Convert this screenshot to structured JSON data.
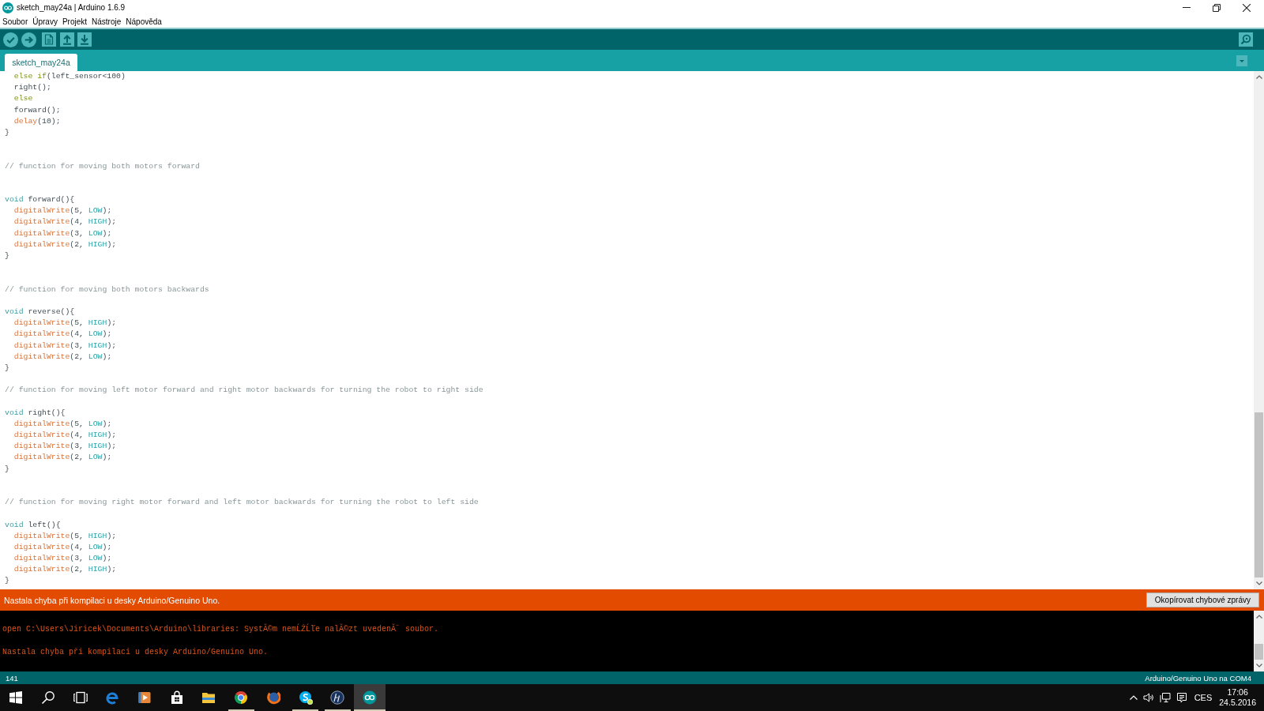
{
  "window": {
    "title": "sketch_may24a | Arduino 1.6.9"
  },
  "menu": [
    "Soubor",
    "Úpravy",
    "Projekt",
    "Nástroje",
    "Nápověda"
  ],
  "tabs": [
    {
      "label": "sketch_may24a",
      "selected": true
    }
  ],
  "editor": {
    "lines": [
      {
        "kind": "code",
        "tokens": [
          {
            "kind": "keyword",
            "text": "  else if"
          },
          {
            "kind": "plain",
            "text": "(left_sensor<100)"
          }
        ]
      },
      {
        "kind": "code",
        "tokens": [
          {
            "kind": "plain",
            "text": "  right();"
          }
        ]
      },
      {
        "kind": "code",
        "tokens": [
          {
            "kind": "keyword",
            "text": "  else"
          }
        ]
      },
      {
        "kind": "code",
        "tokens": [
          {
            "kind": "plain",
            "text": "  forward();"
          }
        ]
      },
      {
        "kind": "code",
        "tokens": [
          {
            "kind": "function",
            "text": "  delay"
          },
          {
            "kind": "plain",
            "text": "(10);"
          }
        ]
      },
      {
        "kind": "code",
        "tokens": [
          {
            "kind": "plain",
            "text": "}"
          }
        ]
      },
      {
        "kind": "blank"
      },
      {
        "kind": "blank"
      },
      {
        "kind": "code",
        "tokens": [
          {
            "kind": "comment",
            "text": "// function for moving both motors forward"
          }
        ]
      },
      {
        "kind": "blank"
      },
      {
        "kind": "blank"
      },
      {
        "kind": "code",
        "tokens": [
          {
            "kind": "type",
            "text": "void"
          },
          {
            "kind": "plain",
            "text": " forward(){"
          }
        ]
      },
      {
        "kind": "code",
        "tokens": [
          {
            "kind": "function",
            "text": "  digitalWrite"
          },
          {
            "kind": "plain",
            "text": "(5, "
          },
          {
            "kind": "constant",
            "text": "LOW"
          },
          {
            "kind": "plain",
            "text": ");"
          }
        ]
      },
      {
        "kind": "code",
        "tokens": [
          {
            "kind": "function",
            "text": "  digitalWrite"
          },
          {
            "kind": "plain",
            "text": "(4, "
          },
          {
            "kind": "constant",
            "text": "HIGH"
          },
          {
            "kind": "plain",
            "text": ");"
          }
        ]
      },
      {
        "kind": "code",
        "tokens": [
          {
            "kind": "function",
            "text": "  digitalWrite"
          },
          {
            "kind": "plain",
            "text": "(3, "
          },
          {
            "kind": "constant",
            "text": "LOW"
          },
          {
            "kind": "plain",
            "text": ");"
          }
        ]
      },
      {
        "kind": "code",
        "tokens": [
          {
            "kind": "function",
            "text": "  digitalWrite"
          },
          {
            "kind": "plain",
            "text": "(2, "
          },
          {
            "kind": "constant",
            "text": "HIGH"
          },
          {
            "kind": "plain",
            "text": ");"
          }
        ]
      },
      {
        "kind": "code",
        "tokens": [
          {
            "kind": "plain",
            "text": "}"
          }
        ]
      },
      {
        "kind": "blank"
      },
      {
        "kind": "blank"
      },
      {
        "kind": "code",
        "tokens": [
          {
            "kind": "comment",
            "text": "// function for moving both motors backwards"
          }
        ]
      },
      {
        "kind": "blank"
      },
      {
        "kind": "code",
        "tokens": [
          {
            "kind": "type",
            "text": "void"
          },
          {
            "kind": "plain",
            "text": " reverse(){"
          }
        ]
      },
      {
        "kind": "code",
        "tokens": [
          {
            "kind": "function",
            "text": "  digitalWrite"
          },
          {
            "kind": "plain",
            "text": "(5, "
          },
          {
            "kind": "constant",
            "text": "HIGH"
          },
          {
            "kind": "plain",
            "text": ");"
          }
        ]
      },
      {
        "kind": "code",
        "tokens": [
          {
            "kind": "function",
            "text": "  digitalWrite"
          },
          {
            "kind": "plain",
            "text": "(4, "
          },
          {
            "kind": "constant",
            "text": "LOW"
          },
          {
            "kind": "plain",
            "text": ");"
          }
        ]
      },
      {
        "kind": "code",
        "tokens": [
          {
            "kind": "function",
            "text": "  digitalWrite"
          },
          {
            "kind": "plain",
            "text": "(3, "
          },
          {
            "kind": "constant",
            "text": "HIGH"
          },
          {
            "kind": "plain",
            "text": ");"
          }
        ]
      },
      {
        "kind": "code",
        "tokens": [
          {
            "kind": "function",
            "text": "  digitalWrite"
          },
          {
            "kind": "plain",
            "text": "(2, "
          },
          {
            "kind": "constant",
            "text": "LOW"
          },
          {
            "kind": "plain",
            "text": ");"
          }
        ]
      },
      {
        "kind": "code",
        "tokens": [
          {
            "kind": "plain",
            "text": "}"
          }
        ]
      },
      {
        "kind": "blank"
      },
      {
        "kind": "code",
        "tokens": [
          {
            "kind": "comment",
            "text": "// function for moving left motor forward and right motor backwards for turning the robot to right side"
          }
        ]
      },
      {
        "kind": "blank"
      },
      {
        "kind": "code",
        "tokens": [
          {
            "kind": "type",
            "text": "void"
          },
          {
            "kind": "plain",
            "text": " right(){"
          }
        ]
      },
      {
        "kind": "code",
        "tokens": [
          {
            "kind": "function",
            "text": "  digitalWrite"
          },
          {
            "kind": "plain",
            "text": "(5, "
          },
          {
            "kind": "constant",
            "text": "LOW"
          },
          {
            "kind": "plain",
            "text": ");"
          }
        ]
      },
      {
        "kind": "code",
        "tokens": [
          {
            "kind": "function",
            "text": "  digitalWrite"
          },
          {
            "kind": "plain",
            "text": "(4, "
          },
          {
            "kind": "constant",
            "text": "HIGH"
          },
          {
            "kind": "plain",
            "text": ");"
          }
        ]
      },
      {
        "kind": "code",
        "tokens": [
          {
            "kind": "function",
            "text": "  digitalWrite"
          },
          {
            "kind": "plain",
            "text": "(3, "
          },
          {
            "kind": "constant",
            "text": "HIGH"
          },
          {
            "kind": "plain",
            "text": ");"
          }
        ]
      },
      {
        "kind": "code",
        "tokens": [
          {
            "kind": "function",
            "text": "  digitalWrite"
          },
          {
            "kind": "plain",
            "text": "(2, "
          },
          {
            "kind": "constant",
            "text": "LOW"
          },
          {
            "kind": "plain",
            "text": ");"
          }
        ]
      },
      {
        "kind": "code",
        "tokens": [
          {
            "kind": "plain",
            "text": "}"
          }
        ]
      },
      {
        "kind": "blank"
      },
      {
        "kind": "blank"
      },
      {
        "kind": "code",
        "tokens": [
          {
            "kind": "comment",
            "text": "// function for moving right motor forward and left motor backwards for turning the robot to left side"
          }
        ]
      },
      {
        "kind": "blank"
      },
      {
        "kind": "code",
        "tokens": [
          {
            "kind": "type",
            "text": "void"
          },
          {
            "kind": "plain",
            "text": " left(){"
          }
        ]
      },
      {
        "kind": "code",
        "tokens": [
          {
            "kind": "function",
            "text": "  digitalWrite"
          },
          {
            "kind": "plain",
            "text": "(5, "
          },
          {
            "kind": "constant",
            "text": "HIGH"
          },
          {
            "kind": "plain",
            "text": ");"
          }
        ]
      },
      {
        "kind": "code",
        "tokens": [
          {
            "kind": "function",
            "text": "  digitalWrite"
          },
          {
            "kind": "plain",
            "text": "(4, "
          },
          {
            "kind": "constant",
            "text": "LOW"
          },
          {
            "kind": "plain",
            "text": ");"
          }
        ]
      },
      {
        "kind": "code",
        "tokens": [
          {
            "kind": "function",
            "text": "  digitalWrite"
          },
          {
            "kind": "plain",
            "text": "(3, "
          },
          {
            "kind": "constant",
            "text": "LOW"
          },
          {
            "kind": "plain",
            "text": ");"
          }
        ]
      },
      {
        "kind": "code",
        "tokens": [
          {
            "kind": "function",
            "text": "  digitalWrite"
          },
          {
            "kind": "plain",
            "text": "(2, "
          },
          {
            "kind": "constant",
            "text": "HIGH"
          },
          {
            "kind": "plain",
            "text": ");"
          }
        ]
      },
      {
        "kind": "code",
        "tokens": [
          {
            "kind": "plain",
            "text": "}"
          }
        ]
      }
    ]
  },
  "error_bar": {
    "message": "Nastala chyba při kompilaci u desky Arduino/Genuino Uno.",
    "button": "Okopírovat chybové zprávy"
  },
  "console": {
    "lines": [
      "open C:\\Users\\Jiricek\\Documents\\Arduino\\libraries: SystĂ©m nemĹŻĹľe nalĂ©zt uvedenĂ˝ soubor.",
      "Nastala chyba při kompilaci u desky Arduino/Genuino Uno."
    ]
  },
  "status_bar": {
    "line": "141",
    "board": "Arduino/Genuino Uno na COM4"
  },
  "taskbar": {
    "apps": [
      {
        "kind": "start",
        "selected": false
      },
      {
        "kind": "search",
        "selected": false
      },
      {
        "kind": "task-view",
        "selected": false
      },
      {
        "kind": "edge",
        "running": false,
        "selected": false
      },
      {
        "kind": "media",
        "running": false,
        "selected": false
      },
      {
        "kind": "store",
        "running": false,
        "selected": false
      },
      {
        "kind": "explorer",
        "running": false,
        "selected": false
      },
      {
        "kind": "chrome",
        "running": true,
        "selected": false
      },
      {
        "kind": "firefox",
        "running": false,
        "selected": false
      },
      {
        "kind": "skype",
        "running": true,
        "selected": false
      },
      {
        "kind": "hp",
        "running": true,
        "selected": false
      },
      {
        "kind": "arduino",
        "running": true,
        "selected": true
      }
    ],
    "tray": {
      "language": "CES",
      "time": "17:06",
      "date": "24.5.2016"
    }
  }
}
